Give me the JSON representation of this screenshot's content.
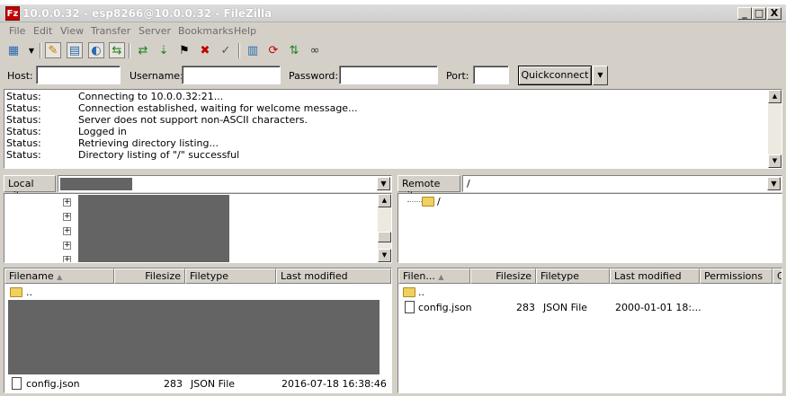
{
  "window": {
    "title": "10.0.0.32 - esp8266@10.0.0.32 - FileZilla",
    "app_icon_text": "Fz"
  },
  "window_buttons": {
    "minimize": "_",
    "maximize": "□",
    "close": "X"
  },
  "menu": [
    "File",
    "Edit",
    "View",
    "Transfer",
    "Server",
    "Bookmarks",
    "Help"
  ],
  "toolbar_icons": [
    "site-manager-icon",
    "dropdown-arrow-icon",
    "toggle-message-log-icon",
    "toggle-local-tree-icon",
    "toggle-remote-tree-icon",
    "toggle-transfer-queue-icon",
    "refresh-icon",
    "process-queue-icon",
    "cancel-operation-icon",
    "disconnect-icon",
    "reconnect-icon",
    "directory-listing-filters-icon",
    "toggle-directory-comparison-icon",
    "synchronized-browsing-icon",
    "search-remote-files-icon"
  ],
  "quickconnect": {
    "host_label": "Host:",
    "host_value": "",
    "username_label": "Username:",
    "username_value": "",
    "password_label": "Password:",
    "password_value": "",
    "port_label": "Port:",
    "port_value": "",
    "button_label": "Quickconnect"
  },
  "log": [
    {
      "type": "Status:",
      "message": "Connecting to 10.0.0.32:21..."
    },
    {
      "type": "Status:",
      "message": "Connection established, waiting for welcome message..."
    },
    {
      "type": "Status:",
      "message": "Server does not support non-ASCII characters."
    },
    {
      "type": "Status:",
      "message": "Logged in"
    },
    {
      "type": "Status:",
      "message": "Retrieving directory listing..."
    },
    {
      "type": "Status:",
      "message": "Directory listing of \"/\" successful"
    }
  ],
  "local": {
    "site_label": "Local site:",
    "path": "",
    "columns": [
      "Filename",
      "Filesize",
      "Filetype",
      "Last modified"
    ],
    "parent_dir": "..",
    "files": [
      {
        "name": "config.json",
        "size": "283",
        "type": "JSON File",
        "modified": "2016-07-18 16:38:46"
      }
    ]
  },
  "remote": {
    "site_label": "Remote site:",
    "path": "/",
    "tree_root": "/",
    "columns": [
      "Filen...",
      "Filesize",
      "Filetype",
      "Last modified",
      "Permissions",
      "C"
    ],
    "parent_dir": "..",
    "files": [
      {
        "name": "config.json",
        "size": "283",
        "type": "JSON File",
        "modified": "2000-01-01 18:..."
      }
    ]
  },
  "colors": {
    "redaction": "#646464",
    "folder": "#f0d060",
    "chrome": "#d4d0c8"
  }
}
